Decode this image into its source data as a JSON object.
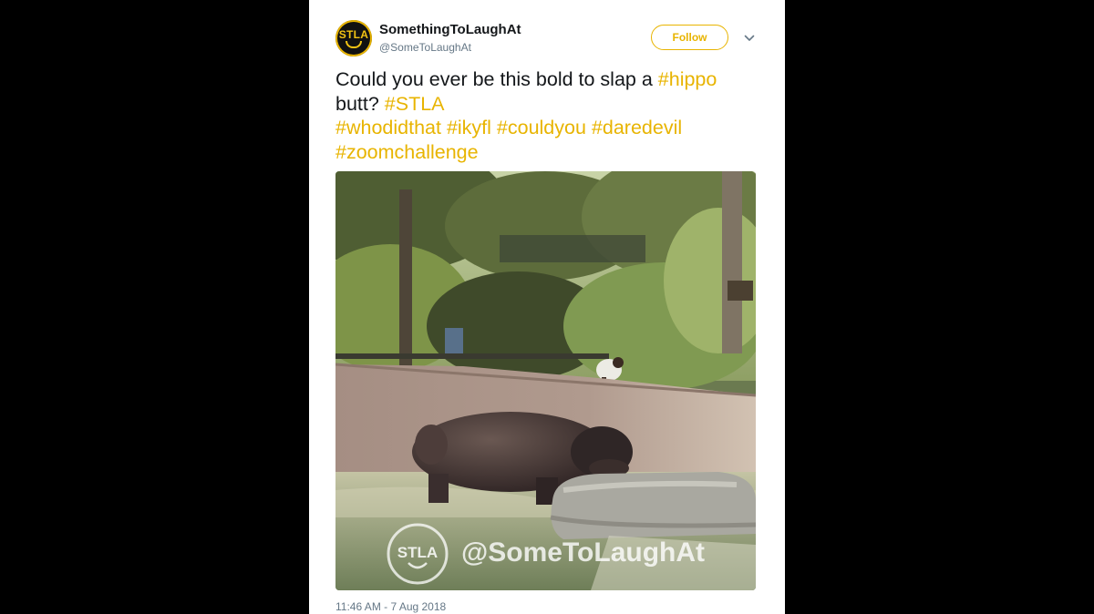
{
  "tweet": {
    "author_name": "SomethingToLaughAt",
    "author_handle": "@SomeToLaughAt",
    "avatar_text": "STLA",
    "follow_label": "Follow",
    "text": {
      "line1_plain": "Could you ever be this bold to slap a ",
      "tag_hippo": "#hippo",
      "line2_plain": "butt? ",
      "tag_stla": "#STLA",
      "tag_whodidthat": "#whodidthat",
      "tag_ikyfl": "#ikyfl",
      "tag_couldyou": "#couldyou",
      "tag_daredevil": "#daredevil",
      "tag_zoomchallenge": "#zoomchallenge"
    },
    "media": {
      "watermark_logo_text": "STLA",
      "watermark_handle": "@SomeToLaughAt"
    },
    "timestamp": "11:46 AM - 7 Aug 2018"
  },
  "colors": {
    "accent": "#e8b400",
    "text": "#14171a",
    "muted": "#657786",
    "backdrop": "#000000"
  },
  "icons": {
    "menu": "chevron-down-icon"
  }
}
